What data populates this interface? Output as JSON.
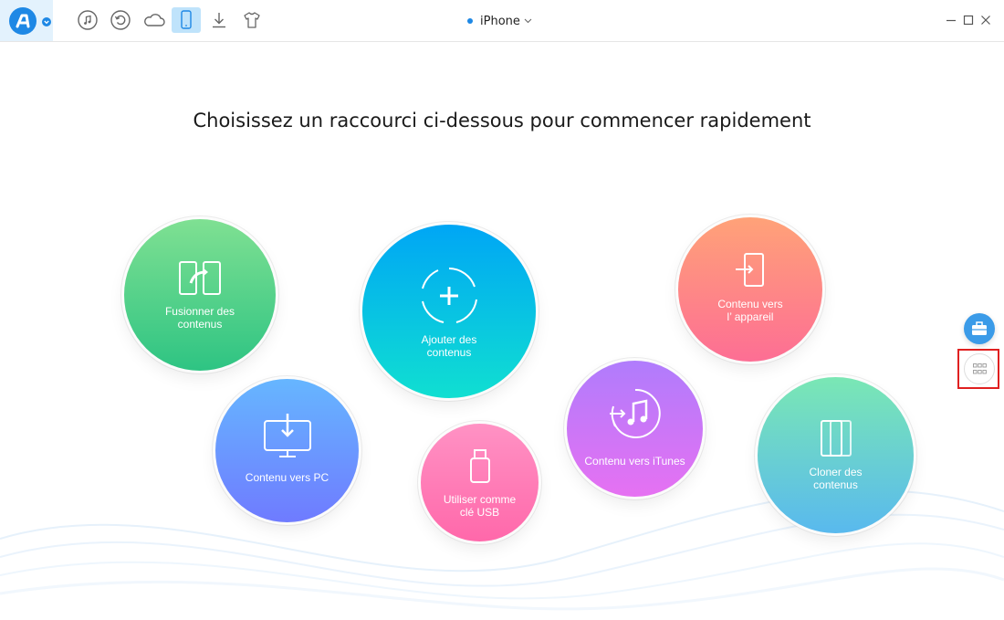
{
  "toolbar": {
    "icons": [
      "music-icon",
      "restore-icon",
      "cloud-icon",
      "phone-icon",
      "download-icon",
      "tshirt-icon"
    ],
    "active": "phone-icon"
  },
  "device": {
    "name": "iPhone"
  },
  "main": {
    "headline": "Choisissez un raccourci ci-dessous pour commencer rapidement",
    "shortcuts": [
      {
        "id": "merge",
        "line1": "Fusionner des",
        "line2": "contenus",
        "icon": "merge-icon",
        "colors": [
          "#7fe092",
          "#2ec483"
        ]
      },
      {
        "id": "add",
        "line1": "Ajouter des",
        "line2": "contenus",
        "icon": "add-icon",
        "colors": [
          "#00a6f5",
          "#10dfd1"
        ]
      },
      {
        "id": "to-device",
        "line1": "Contenu vers",
        "line2": "l’ appareil",
        "icon": "to-device-icon",
        "colors": [
          "#ffa278",
          "#fd6e94"
        ]
      },
      {
        "id": "to-pc",
        "line1": "Contenu vers PC",
        "line2": "",
        "icon": "to-pc-icon",
        "colors": [
          "#66b6ff",
          "#6f7bff"
        ]
      },
      {
        "id": "usb",
        "line1": "Utiliser comme",
        "line2": "clé USB",
        "icon": "usb-icon",
        "colors": [
          "#ff92c4",
          "#ff68aa"
        ]
      },
      {
        "id": "to-itunes",
        "line1": "Contenu vers iTunes",
        "line2": "",
        "icon": "itunes-icon",
        "colors": [
          "#b07cfc",
          "#e671f2"
        ]
      },
      {
        "id": "clone",
        "line1": "Cloner des",
        "line2": "contenus",
        "icon": "clone-icon",
        "colors": [
          "#7ae7b4",
          "#59b9ee"
        ]
      }
    ]
  },
  "side": {
    "top_icon": "toolbox-icon",
    "bottom_icon": "apps-grid-icon"
  },
  "colors": {
    "accent": "#1e88e5",
    "highlight": "#e02020"
  }
}
